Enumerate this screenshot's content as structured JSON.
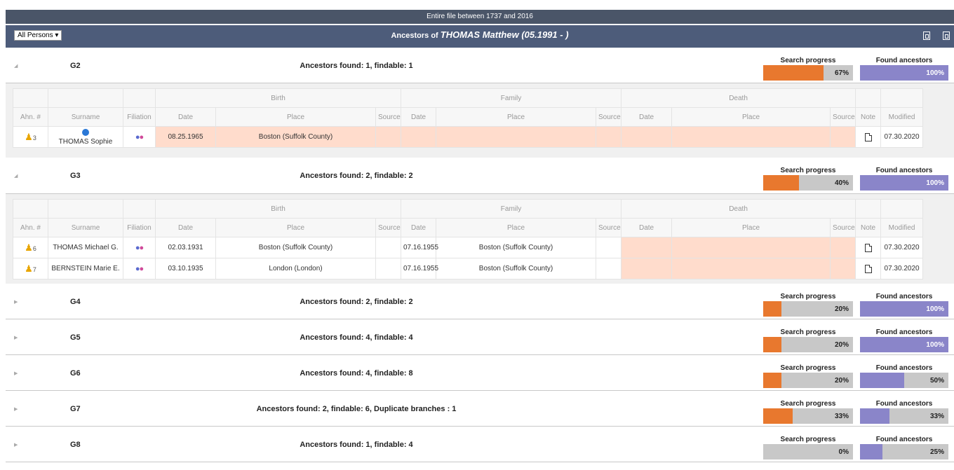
{
  "topbar": {
    "text": "Entire file between 1737 and 2016"
  },
  "header": {
    "select_value": "All Persons ▾",
    "title_prefix": "Ancestors of ",
    "title_name": "THOMAS Matthew (05.1991 - )"
  },
  "labels": {
    "search_progress": "Search progress",
    "found_ancestors": "Found ancestors"
  },
  "table_headers": {
    "ahn": "Ahn. #",
    "surname": "Surname",
    "filiation": "Filiation",
    "birth": "Birth",
    "family": "Family",
    "death": "Death",
    "date": "Date",
    "place": "Place",
    "source": "Source",
    "note": "Note",
    "modified": "Modified"
  },
  "generations": [
    {
      "name": "G2",
      "expanded": true,
      "found_text": "Ancestors found: 1, findable: 1",
      "search_progress": 67,
      "search_progress_label": "67%",
      "found_ancestors": 100,
      "found_ancestors_label": "100%",
      "rows": [
        {
          "ahn": "3",
          "surname": "THOMAS Sophie",
          "birth_date": "08.25.1965",
          "birth_place": "Boston (Suffolk County)",
          "family_date": "",
          "family_place": "",
          "modified": "07.30.2020"
        }
      ]
    },
    {
      "name": "G3",
      "expanded": true,
      "found_text": "Ancestors found: 2, findable: 2",
      "search_progress": 40,
      "search_progress_label": "40%",
      "found_ancestors": 100,
      "found_ancestors_label": "100%",
      "rows": [
        {
          "ahn": "6",
          "surname": "THOMAS Michael G.",
          "birth_date": "02.03.1931",
          "birth_place": "Boston (Suffolk County)",
          "family_date": "07.16.1955",
          "family_place": "Boston (Suffolk County)",
          "modified": "07.30.2020"
        },
        {
          "ahn": "7",
          "surname": "BERNSTEIN Marie E.",
          "birth_date": "03.10.1935",
          "birth_place": "London (London)",
          "family_date": "07.16.1955",
          "family_place": "Boston (Suffolk County)",
          "modified": "07.30.2020"
        }
      ]
    },
    {
      "name": "G4",
      "expanded": false,
      "found_text": "Ancestors found: 2, findable: 2",
      "search_progress": 20,
      "search_progress_label": "20%",
      "found_ancestors": 100,
      "found_ancestors_label": "100%"
    },
    {
      "name": "G5",
      "expanded": false,
      "found_text": "Ancestors found: 4, findable: 4",
      "search_progress": 20,
      "search_progress_label": "20%",
      "found_ancestors": 100,
      "found_ancestors_label": "100%"
    },
    {
      "name": "G6",
      "expanded": false,
      "found_text": "Ancestors found: 4, findable: 8",
      "search_progress": 20,
      "search_progress_label": "20%",
      "found_ancestors": 50,
      "found_ancestors_label": "50%"
    },
    {
      "name": "G7",
      "expanded": false,
      "found_text": "Ancestors found: 2, findable: 6, Duplicate branches : 1",
      "search_progress": 33,
      "search_progress_label": "33%",
      "found_ancestors": 33,
      "found_ancestors_label": "33%"
    },
    {
      "name": "G8",
      "expanded": false,
      "found_text": "Ancestors found: 1, findable: 4",
      "search_progress": 0,
      "search_progress_label": "0%",
      "found_ancestors": 25,
      "found_ancestors_label": "25%"
    }
  ],
  "colors": {
    "header": "#4d5c7a",
    "search_fill": "#e8782e",
    "found_fill": "#8a85c9",
    "missing_cell": "#ffdccc"
  },
  "icons": {
    "expand": "triangle-icon",
    "person": "person-icon",
    "note": "note-icon",
    "pdf": "pdf-icon",
    "excel": "excel-icon"
  }
}
